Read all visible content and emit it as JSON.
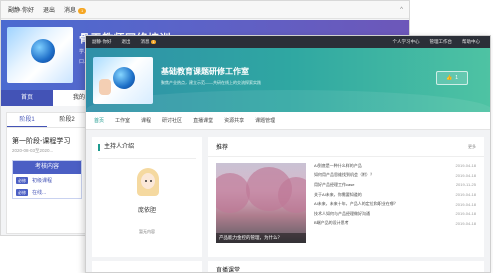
{
  "back_window": {
    "topbar": {
      "greeting": "副静·你好",
      "logout": "退出",
      "messages": "消息",
      "message_count": "1"
    },
    "banner": {
      "title": "骨干教师网络培训",
      "subtitle1": "学...",
      "subtitle2": "口..."
    },
    "nav": {
      "tabs": [
        {
          "label": "首页"
        },
        {
          "label": "我的"
        }
      ]
    },
    "stage_tabs": [
      {
        "label": "阶段1"
      },
      {
        "label": "阶段2"
      }
    ],
    "stage": {
      "title": "第一阶段-课程学习",
      "date": "2020-08-03至2020...",
      "exam_title": "考核内容",
      "rows": [
        {
          "tag": "必修",
          "link": "初级课程"
        },
        {
          "tag": "必修",
          "link": "在线..."
        }
      ]
    }
  },
  "front_window": {
    "topbar": {
      "greeting": "副静·你好",
      "logout": "退出",
      "messages": "消息",
      "message_count": "1",
      "right_links": [
        "个人学习中心",
        "管理工作台",
        "帮助中心"
      ]
    },
    "banner": {
      "title": "基础教育课题研修工作室",
      "subtitle": "聚焦产业热点，建立示范——共研在线上的交流探索实践",
      "like_count": "1"
    },
    "nav": {
      "items": [
        {
          "label": "首页"
        },
        {
          "label": "工作室"
        },
        {
          "label": "课程"
        },
        {
          "label": "研讨社区"
        },
        {
          "label": "直播课堂"
        },
        {
          "label": "资源共享"
        },
        {
          "label": "课题管理"
        }
      ]
    },
    "host": {
      "title": "主持人介绍",
      "name": "庞依胆",
      "desc": "暂无内容"
    },
    "recommend": {
      "title": "推荐",
      "more": "更多",
      "image_caption": "产品能力金控的管理，为什么？",
      "news": [
        {
          "title": "AI到底是一种什么样的产品",
          "date": "2019-04-18"
        },
        {
          "title": "如何用产品思维找到机会（附）？",
          "date": "2019-04-18"
        },
        {
          "title": "用好产品经理工作case",
          "date": "2019-11-25"
        },
        {
          "title": "关于AI未来，你需要知道的",
          "date": "2019-04-18"
        },
        {
          "title": "AI未来，未来十年，产品人的定位和职业在哪？",
          "date": "2019-04-18"
        },
        {
          "title": "技术人如何与产品经理做好沟通",
          "date": "2019-04-18"
        },
        {
          "title": "B端产品的设计思考",
          "date": "2019-04-18"
        }
      ]
    },
    "live": {
      "title": "直播课堂"
    }
  }
}
